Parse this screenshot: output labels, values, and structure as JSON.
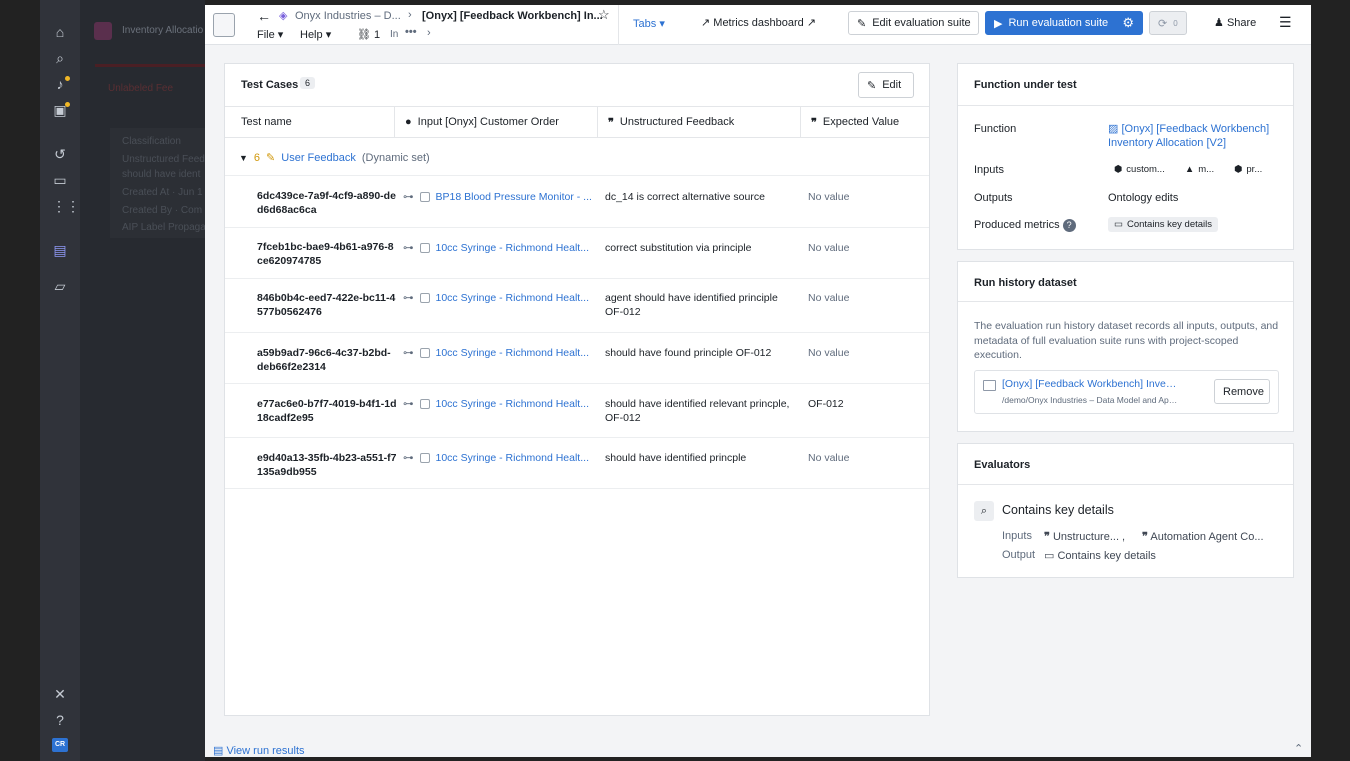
{
  "background": {
    "app_title": "Inventory Allocatio",
    "banner": "Unlabeled Fee",
    "lines": [
      "Classification",
      "Unstructured Feed",
      "should have ident",
      "Created At · Jun 1",
      "Created By · Com",
      "AIP Label Propaga"
    ]
  },
  "sidebar": {
    "avatar": "CR"
  },
  "topbar": {
    "breadcrumb_parent": "Onyx Industries – D...",
    "title": "[Onyx] [Feedback Workbench] In...",
    "menu_file": "File",
    "menu_help": "Help",
    "count": "1",
    "in_label": "In",
    "tabs_label": "Tabs",
    "metrics_label": "Metrics dashboard",
    "edit_suite_label": "Edit evaluation suite",
    "run_suite_label": "Run evaluation suite",
    "refresh_count": "0",
    "share_label": "Share"
  },
  "test_cases": {
    "title": "Test Cases",
    "count": "6",
    "edit_label": "Edit",
    "columns": [
      "Test name",
      "Input [Onyx] Customer Order",
      "Unstructured Feedback",
      "Expected Value"
    ],
    "group": {
      "count": "6",
      "name": "User Feedback",
      "type": "(Dynamic set)"
    },
    "rows": [
      {
        "id": "6dc439ce-7a9f-4cf9-a890-ded6d68ac6ca",
        "input": "BP18 Blood Pressure Monitor - ...",
        "feedback": "dc_14 is correct alternative source",
        "expected": "No value"
      },
      {
        "id": "7fceb1bc-bae9-4b61-a976-8ce620974785",
        "input": "10cc Syringe - Richmond Healt...",
        "feedback": "correct substitution via principle",
        "expected": "No value"
      },
      {
        "id": "846b0b4c-eed7-422e-bc11-4577b0562476",
        "input": "10cc Syringe - Richmond Healt...",
        "feedback": "agent should have identified principle OF-012",
        "expected": "No value"
      },
      {
        "id": "a59b9ad7-96c6-4c37-b2bd-deb66f2e2314",
        "input": "10cc Syringe - Richmond Healt...",
        "feedback": "should have found principle OF-012",
        "expected": "No value"
      },
      {
        "id": "e77ac6e0-b7f7-4019-b4f1-1d18cadf2e95",
        "input": "10cc Syringe - Richmond Healt...",
        "feedback": "should have identified relevant princple, OF-012",
        "expected": "OF-012"
      },
      {
        "id": "e9d40a13-35fb-4b23-a551-f7135a9db955",
        "input": "10cc Syringe - Richmond Healt...",
        "feedback": "should have identified princple",
        "expected": "No value"
      }
    ]
  },
  "function_under_test": {
    "title": "Function under test",
    "function_label": "Function",
    "function_value_line1": "[Onyx] [Feedback Workbench]",
    "function_value_line2": "Inventory Allocation [V2]",
    "inputs_label": "Inputs",
    "inputs": [
      "custom...",
      "m...",
      "pr..."
    ],
    "outputs_label": "Outputs",
    "outputs_value": "Ontology edits",
    "metrics_label": "Produced metrics",
    "metrics_value": "Contains key details"
  },
  "run_history": {
    "title": "Run history dataset",
    "description": "The evaluation run history dataset records all inputs, outputs, and metadata of full evaluation suite runs with project-scoped execution.",
    "dataset_name": "[Onyx] [Feedback Workbench] Inventory ...",
    "dataset_path": "/demo/Onyx Industries – Data Model and Applic...",
    "remove_label": "Remove"
  },
  "evaluators": {
    "title": "Evaluators",
    "name": "Contains key details",
    "inputs_label": "Inputs",
    "input1": "Unstructure... ,",
    "input2": "Automation Agent Co...",
    "output_label": "Output",
    "output_value": "Contains key details"
  },
  "footer": {
    "view_results": "View run results"
  }
}
